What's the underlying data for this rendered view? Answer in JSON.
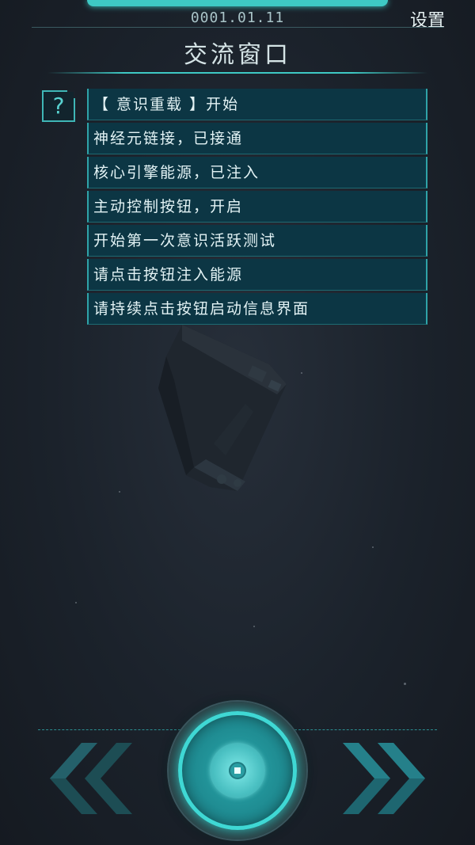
{
  "header": {
    "date": "0001.01.11",
    "settings_label": "设置",
    "title": "交流窗口"
  },
  "help_icon_glyph": "?",
  "messages": [
    "【 意识重载 】开始",
    "神经元链接，已接通",
    "核心引擎能源，已注入",
    "主动控制按钮，开启",
    "开始第一次意识活跃测试",
    "请点击按钮注入能源",
    "请持续点击按钮启动信息界面"
  ],
  "icons": {
    "help": "question-mark-icon",
    "left": "double-chevron-left-icon",
    "right": "double-chevron-right-icon",
    "core": "core-power-button-icon"
  },
  "colors": {
    "accent": "#3ec9c4",
    "panel": "#0c3644",
    "background": "#1b222b"
  }
}
